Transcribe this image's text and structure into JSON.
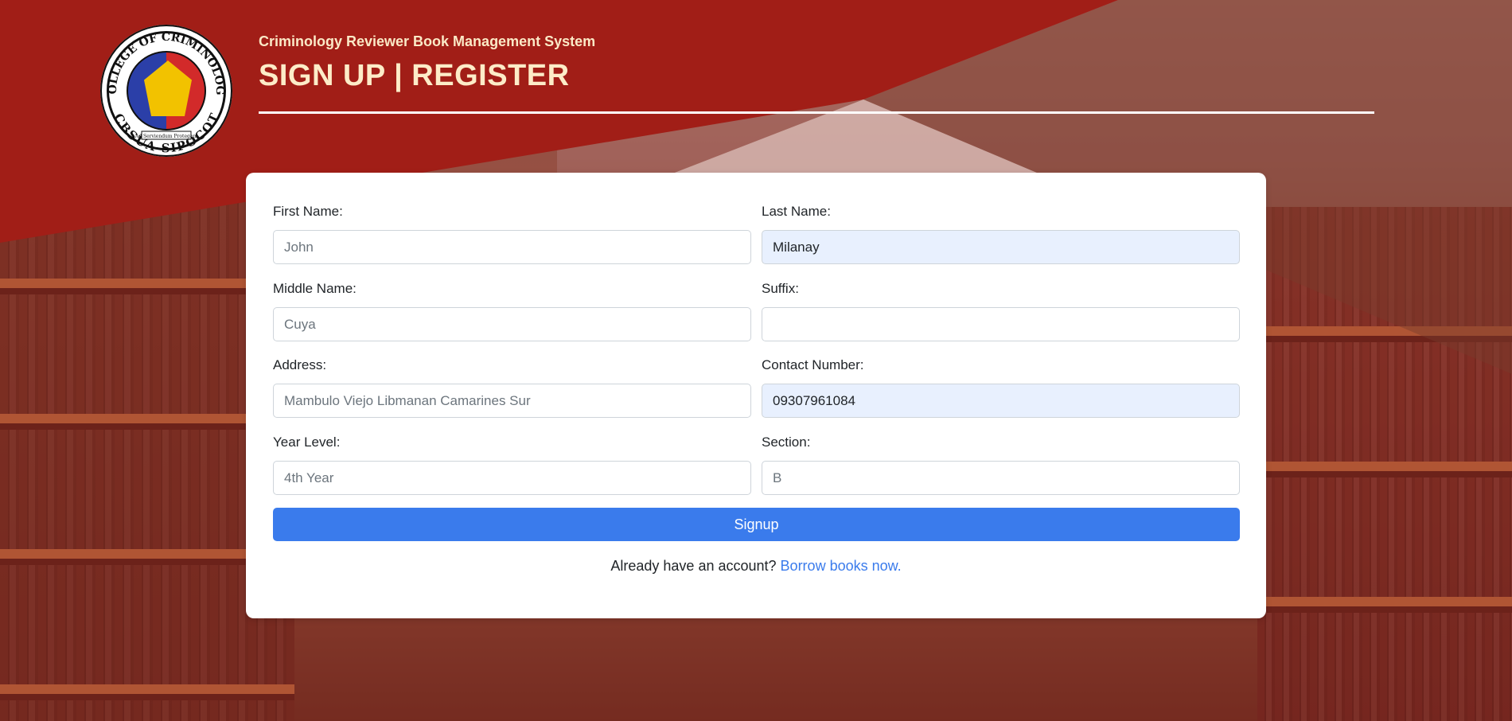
{
  "header": {
    "subtitle": "Criminology Reviewer Book Management System",
    "title": "SIGN UP | REGISTER",
    "logo": {
      "top_text": "COLLEGE OF CRIMINOLOGY",
      "bottom_text": "CBSUA-SIPOCOT",
      "motto": "Ad Serviendum Protegam"
    }
  },
  "form": {
    "first_name": {
      "label": "First Name:",
      "placeholder": "John",
      "value": ""
    },
    "last_name": {
      "label": "Last Name:",
      "placeholder": "",
      "value": "Milanay"
    },
    "middle_name": {
      "label": "Middle Name:",
      "placeholder": "Cuya",
      "value": ""
    },
    "suffix": {
      "label": "Suffix:",
      "placeholder": "",
      "value": ""
    },
    "address": {
      "label": "Address:",
      "placeholder": "Mambulo Viejo Libmanan Camarines Sur",
      "value": ""
    },
    "contact": {
      "label": "Contact Number:",
      "placeholder": "",
      "value": "09307961084"
    },
    "year_level": {
      "label": "Year Level:",
      "placeholder": "4th Year",
      "value": ""
    },
    "section": {
      "label": "Section:",
      "placeholder": "B",
      "value": ""
    },
    "submit_label": "Signup",
    "footer_text": "Already have an account?",
    "footer_link": "Borrow books now."
  },
  "colors": {
    "brand_red": "#a11e17",
    "primary_blue": "#3a7bec",
    "title_cream": "#fdecc8"
  }
}
